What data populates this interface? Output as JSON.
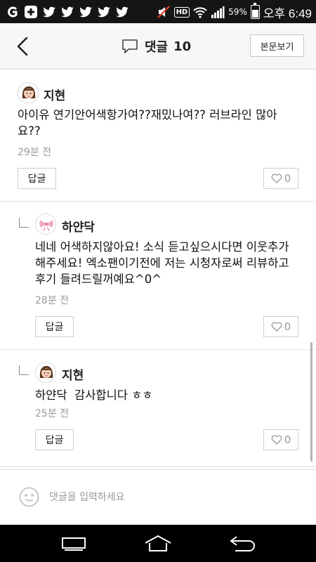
{
  "status_bar": {
    "battery_percent": "59%",
    "time": "오후 6:49",
    "hd_label": "HD",
    "battery_level": 0.59
  },
  "header": {
    "title": "댓글",
    "count": "10",
    "view_post_label": "본문보기"
  },
  "comments": [
    {
      "author": "지현",
      "text": "아이유 연기안어색항가여??재밌나여?? 러브라인 많아요??",
      "time": "29분 전",
      "reply_label": "답글",
      "likes": "0",
      "is_reply": false,
      "avatar": "girl-avatar-icon"
    },
    {
      "author": "하얀닥",
      "text": "네네 어색하지않아요! 소식 듣고싶으시다면 이웃추가해주세요! 엑소팬이기전에 저는 시청자로써 리뷰하고 후기 들려드릴꺼예요^0^",
      "time": "28분 전",
      "reply_label": "답글",
      "likes": "0",
      "is_reply": true,
      "avatar": "ribbon-avatar-icon"
    },
    {
      "author": "지현",
      "text": "하얀닥  감사합니다 ㅎㅎ",
      "time": "25분 전",
      "reply_label": "답글",
      "likes": "0",
      "is_reply": true,
      "avatar": "girl-avatar-icon"
    }
  ],
  "input": {
    "placeholder": "댓글을 입력하세요"
  },
  "colors": {
    "status_bg": "#151515",
    "header_bg": "#f7f7f7",
    "nav_bg": "#000000",
    "muted_text": "#999999"
  }
}
